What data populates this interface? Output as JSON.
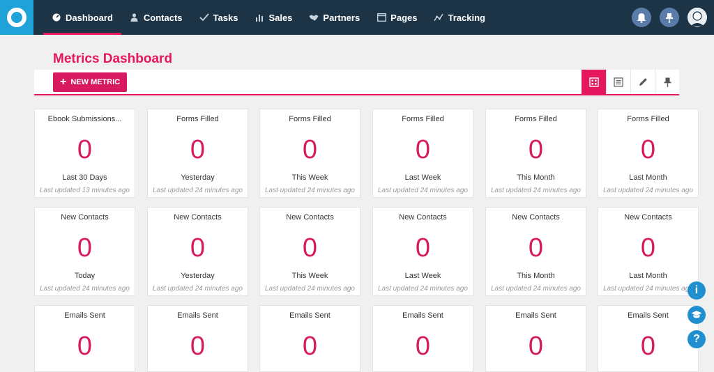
{
  "nav": {
    "items": [
      {
        "label": "Dashboard",
        "icon": "dashboard-icon",
        "active": true
      },
      {
        "label": "Contacts",
        "icon": "person-icon",
        "active": false
      },
      {
        "label": "Tasks",
        "icon": "check-icon",
        "active": false
      },
      {
        "label": "Sales",
        "icon": "bars-icon",
        "active": false
      },
      {
        "label": "Partners",
        "icon": "handshake-icon",
        "active": false
      },
      {
        "label": "Pages",
        "icon": "window-icon",
        "active": false
      },
      {
        "label": "Tracking",
        "icon": "tracking-icon",
        "active": false
      }
    ],
    "accent": "#e4175f",
    "bg": "#1d3447"
  },
  "page": {
    "title": "Metrics Dashboard",
    "new_metric_label": "NEW METRIC"
  },
  "cards": [
    {
      "title": "Ebook Submissions...",
      "value": "0",
      "period": "Last 30 Days",
      "updated": "Last updated 13 minutes ago"
    },
    {
      "title": "Forms Filled",
      "value": "0",
      "period": "Yesterday",
      "updated": "Last updated 24 minutes ago"
    },
    {
      "title": "Forms Filled",
      "value": "0",
      "period": "This Week",
      "updated": "Last updated 24 minutes ago"
    },
    {
      "title": "Forms Filled",
      "value": "0",
      "period": "Last Week",
      "updated": "Last updated 24 minutes ago"
    },
    {
      "title": "Forms Filled",
      "value": "0",
      "period": "This Month",
      "updated": "Last updated 24 minutes ago"
    },
    {
      "title": "Forms Filled",
      "value": "0",
      "period": "Last Month",
      "updated": "Last updated 24 minutes ago"
    },
    {
      "title": "New Contacts",
      "value": "0",
      "period": "Today",
      "updated": "Last updated 24 minutes ago"
    },
    {
      "title": "New Contacts",
      "value": "0",
      "period": "Yesterday",
      "updated": "Last updated 24 minutes ago"
    },
    {
      "title": "New Contacts",
      "value": "0",
      "period": "This Week",
      "updated": "Last updated 24 minutes ago"
    },
    {
      "title": "New Contacts",
      "value": "0",
      "period": "Last Week",
      "updated": "Last updated 24 minutes ago"
    },
    {
      "title": "New Contacts",
      "value": "0",
      "period": "This Month",
      "updated": "Last updated 24 minutes ago"
    },
    {
      "title": "New Contacts",
      "value": "0",
      "period": "Last Month",
      "updated": "Last updated 24 minutes ago"
    },
    {
      "title": "Emails Sent",
      "value": "0",
      "period": "",
      "updated": ""
    },
    {
      "title": "Emails Sent",
      "value": "0",
      "period": "",
      "updated": ""
    },
    {
      "title": "Emails Sent",
      "value": "0",
      "period": "",
      "updated": ""
    },
    {
      "title": "Emails Sent",
      "value": "0",
      "period": "",
      "updated": ""
    },
    {
      "title": "Emails Sent",
      "value": "0",
      "period": "",
      "updated": ""
    },
    {
      "title": "Emails Sent",
      "value": "0",
      "period": "",
      "updated": ""
    }
  ],
  "side": {
    "info_label": "i",
    "help_label": "?"
  }
}
